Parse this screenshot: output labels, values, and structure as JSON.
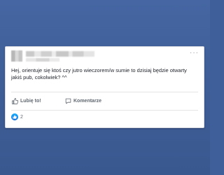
{
  "post": {
    "more_label": "···",
    "text_line1": "Hej, orientuje się ktoś czy jutro wieczorem/w sumie to dzisiaj będzie otwarty",
    "text_line2": "jakiś pub, cokolwiek? ^^"
  },
  "actions": {
    "like_label": "Lubię to!",
    "like_icon": "thumbs-up-icon",
    "comment_label": "Komentarze",
    "comment_icon": "comment-icon"
  },
  "reactions": {
    "count": "2",
    "icon": "like-reaction-icon",
    "color": "#1877f2"
  },
  "colors": {
    "background": "#3f5f9a",
    "card": "#ffffff",
    "text": "#1d2129",
    "secondary_text": "#606770"
  }
}
